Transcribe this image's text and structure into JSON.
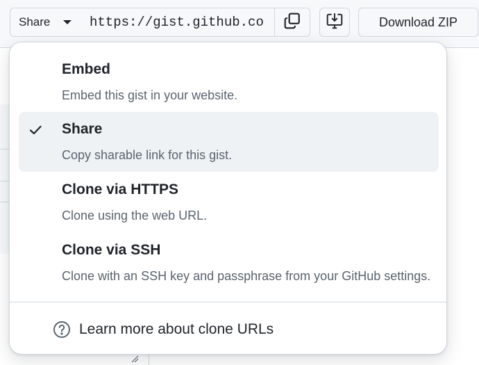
{
  "toolbar": {
    "share_label": "Share",
    "url_value": "https://gist.github.com",
    "download_zip_label": "Download ZIP"
  },
  "menu": {
    "items": [
      {
        "title": "Embed",
        "description": "Embed this gist in your website.",
        "selected": false
      },
      {
        "title": "Share",
        "description": "Copy sharable link for this gist.",
        "selected": true
      },
      {
        "title": "Clone via HTTPS",
        "description": "Clone using the web URL.",
        "selected": false
      },
      {
        "title": "Clone via SSH",
        "description": "Clone with an SSH key and passphrase from your GitHub settings.",
        "selected": false
      }
    ],
    "footer_link": "Learn more about clone URLs"
  },
  "icons": {
    "copy": "copy-icon",
    "desktop": "desktop-download-icon",
    "check": "check-icon",
    "help": "question-circle-icon"
  },
  "colors": {
    "text": "#1f2328",
    "muted": "#59636e",
    "border": "#d1d9e0",
    "selected_bg": "#eff2f5"
  }
}
